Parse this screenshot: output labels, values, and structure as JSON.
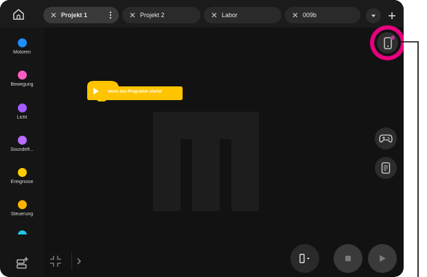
{
  "tabs": [
    {
      "label": "Projekt 1",
      "active": true
    },
    {
      "label": "Projekt 2",
      "active": false
    },
    {
      "label": "Labor",
      "active": false
    },
    {
      "label": "009b",
      "active": false
    }
  ],
  "categories": [
    {
      "name": "Motoren",
      "color": "#1e8fff"
    },
    {
      "name": "Bewegung",
      "color": "#ff5dc4"
    },
    {
      "name": "Licht",
      "color": "#a45cff"
    },
    {
      "name": "Soundeff...",
      "color": "#b96cff"
    },
    {
      "name": "Ereignisse",
      "color": "#ffcc00"
    },
    {
      "name": "Steuerung",
      "color": "#ffb300"
    },
    {
      "name": "",
      "color": "#22c6e6"
    }
  ],
  "canvas": {
    "hat_block_label": "wenn das Programm startet",
    "hat_block_color": "#ffc400"
  },
  "icons": {
    "home": "home-icon",
    "phone": "phone-icon",
    "gamepad": "gamepad-icon",
    "document": "document-icon"
  },
  "colors": {
    "highlight": "#e6007e",
    "background": "#121212"
  }
}
